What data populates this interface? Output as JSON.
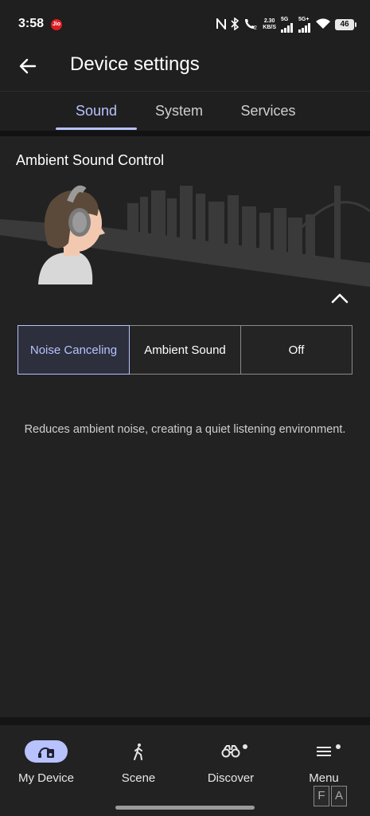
{
  "status_bar": {
    "time": "3:58",
    "carrier_badge": "Jio",
    "net_speed_value": "2.30",
    "net_speed_unit": "KB/S",
    "sim1_label": "5G",
    "sim2_label": "5G+",
    "battery": "46",
    "icons": [
      "nfc-icon",
      "bluetooth-icon",
      "wifi-calling-icon",
      "signal-icon",
      "signal-icon",
      "wifi-icon",
      "battery-icon"
    ]
  },
  "header": {
    "title": "Device settings",
    "back_icon": "back-arrow-icon"
  },
  "tabs": [
    {
      "label": "Sound",
      "active": true
    },
    {
      "label": "System",
      "active": false
    },
    {
      "label": "Services",
      "active": false
    }
  ],
  "ambient": {
    "title": "Ambient Sound Control",
    "modes": [
      {
        "label": "Noise Canceling",
        "selected": true
      },
      {
        "label": "Ambient Sound",
        "selected": false
      },
      {
        "label": "Off",
        "selected": false
      }
    ],
    "description": "Reduces ambient noise, creating a quiet listening environment."
  },
  "bottom_nav": [
    {
      "label": "My Device",
      "icon": "headphones-device-icon",
      "active": true,
      "dot": false
    },
    {
      "label": "Scene",
      "icon": "walking-person-icon",
      "active": false,
      "dot": false
    },
    {
      "label": "Discover",
      "icon": "binoculars-icon",
      "active": false,
      "dot": true
    },
    {
      "label": "Menu",
      "icon": "menu-icon",
      "active": false,
      "dot": true
    }
  ],
  "watermark": {
    "letters": [
      "F",
      "A"
    ]
  },
  "colors": {
    "accent": "#b7c2ff",
    "background": "#222222",
    "bar_background": "#1f1f1f"
  }
}
